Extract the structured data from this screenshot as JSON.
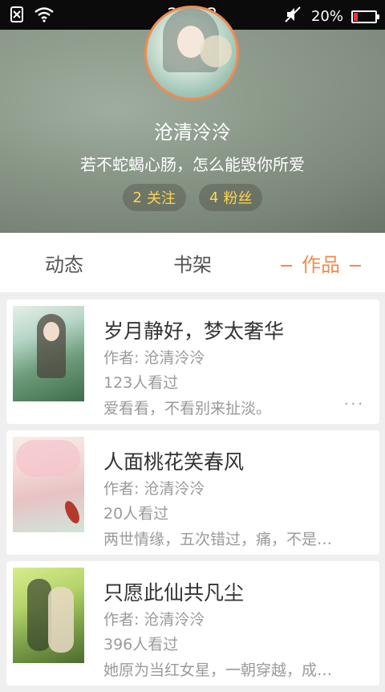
{
  "status_bar": {
    "time": "23:23",
    "battery": "20%",
    "battery_level": 0.2,
    "icons": [
      "sim-off-icon",
      "wifi-icon",
      "mute-icon",
      "battery-icon"
    ]
  },
  "profile": {
    "name": "沧清泠泠",
    "motto": "若不蛇蝎心肠，怎么能毁你所爱",
    "following_count": "2",
    "following_label": "关注",
    "followers_count": "4",
    "followers_label": "粉丝"
  },
  "tabs": [
    {
      "label": "动态",
      "active": false
    },
    {
      "label": "书架",
      "active": false
    },
    {
      "label": "作品",
      "active": true
    }
  ],
  "works": [
    {
      "title": "岁月静好，梦太奢华",
      "author": "作者: 沧清泠泠",
      "views": "123人看过",
      "desc": "爱看看，不看别来扯淡。",
      "more": "···"
    },
    {
      "title": "人面桃花笑春风",
      "author": "作者: 沧清泠泠",
      "views": "20人看过",
      "desc": "两世情缘，五次错过，痛，不是…",
      "more": ""
    },
    {
      "title": "只愿此仙共凡尘",
      "author": "作者: 沧清泠泠",
      "views": "396人看过",
      "desc": "她原为当红女星，一朝穿越，成…",
      "more": ""
    }
  ],
  "colors": {
    "accent": "#f28a4e",
    "pill_text": "#ffd54f",
    "status_bar": "#0b0b0b"
  }
}
